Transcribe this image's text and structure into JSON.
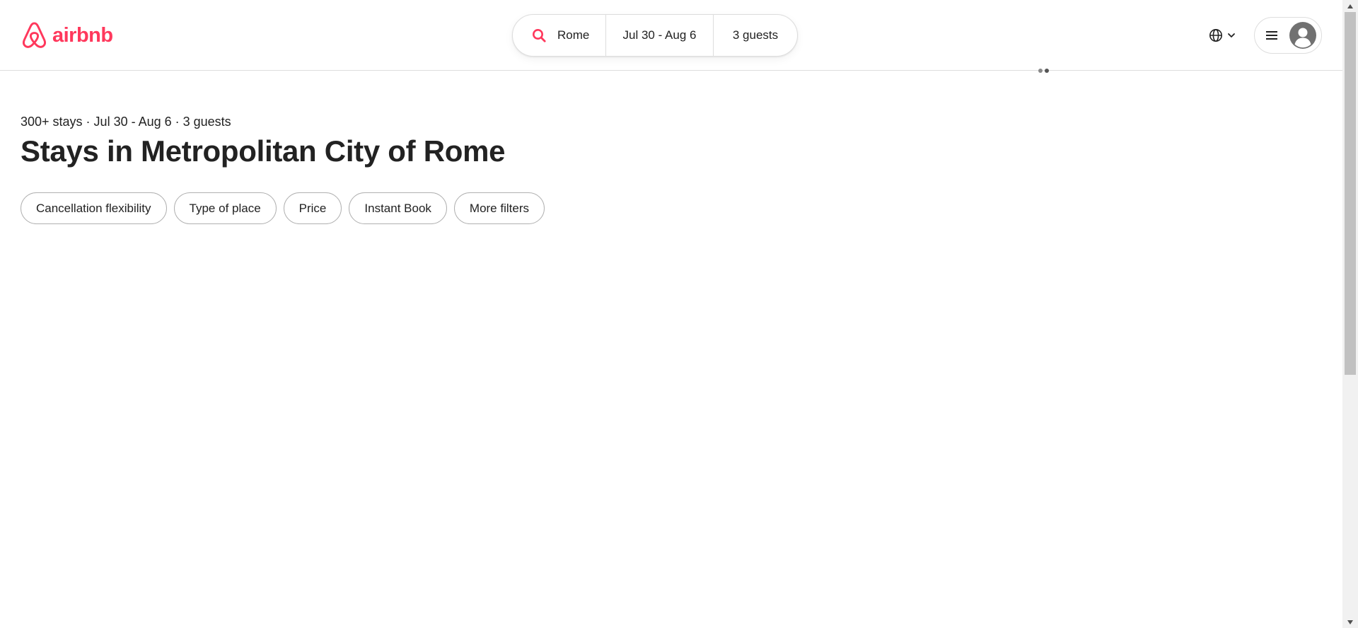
{
  "header": {
    "logo_text": "airbnb",
    "brand_color": "#FF385C",
    "search": {
      "icon": "search-icon",
      "location": "Rome",
      "dates": "Jul 30 - Aug 6",
      "guests": "3 guests"
    },
    "language_icon": "globe-icon",
    "menu_icon": "hamburger-menu-icon",
    "avatar_icon": "user-avatar-icon"
  },
  "main": {
    "summary": "300+ stays · Jul 30 - Aug 6 · 3 guests",
    "title": "Stays in Metropolitan City of Rome",
    "filters": [
      {
        "label": "Cancellation flexibility"
      },
      {
        "label": "Type of place"
      },
      {
        "label": "Price"
      },
      {
        "label": "Instant Book"
      },
      {
        "label": "More filters"
      }
    ]
  }
}
